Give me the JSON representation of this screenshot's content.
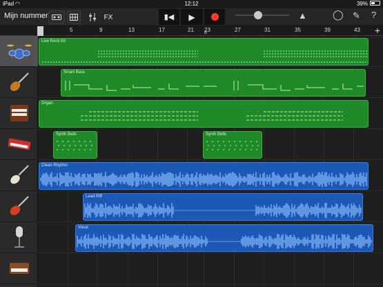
{
  "status_bar": {
    "device": "iPad",
    "time": "12:12",
    "battery": "39%"
  },
  "toolbar": {
    "title": "Mijn nummers",
    "fx_label": "FX"
  },
  "ruler": {
    "bars": [
      "1",
      "5",
      "9",
      "13",
      "17",
      "21",
      "23",
      "27",
      "31",
      "35",
      "39",
      "43"
    ],
    "sub_label": "B"
  },
  "tracks": [
    {
      "instrument": "drum-kit",
      "region": "Live Rock Kit",
      "color": "#1f8a27"
    },
    {
      "instrument": "bass-guitar",
      "region": "Smart Bass",
      "color": "#1f8a27"
    },
    {
      "instrument": "organ",
      "region": "Organ",
      "color": "#1f8a27"
    },
    {
      "instrument": "keyboard-synth",
      "region": "Synth Bells",
      "color": "#1f8a27"
    },
    {
      "instrument": "electric-guitar",
      "region": "Clean Rhythm",
      "color": "#1c58b5"
    },
    {
      "instrument": "electric-guitar-red",
      "region": "Lead Riff",
      "color": "#1c58b5"
    },
    {
      "instrument": "microphone",
      "region": "Vocal",
      "color": "#1c58b5"
    },
    {
      "instrument": "analog-synth",
      "region": "",
      "color": "#1f8a27"
    }
  ],
  "regions_extra": {
    "synth_bells_2": "Synth Bells"
  },
  "colors": {
    "midi_green": "#1f8a27",
    "audio_blue": "#1c58b5",
    "record_red": "#ff3b30"
  }
}
